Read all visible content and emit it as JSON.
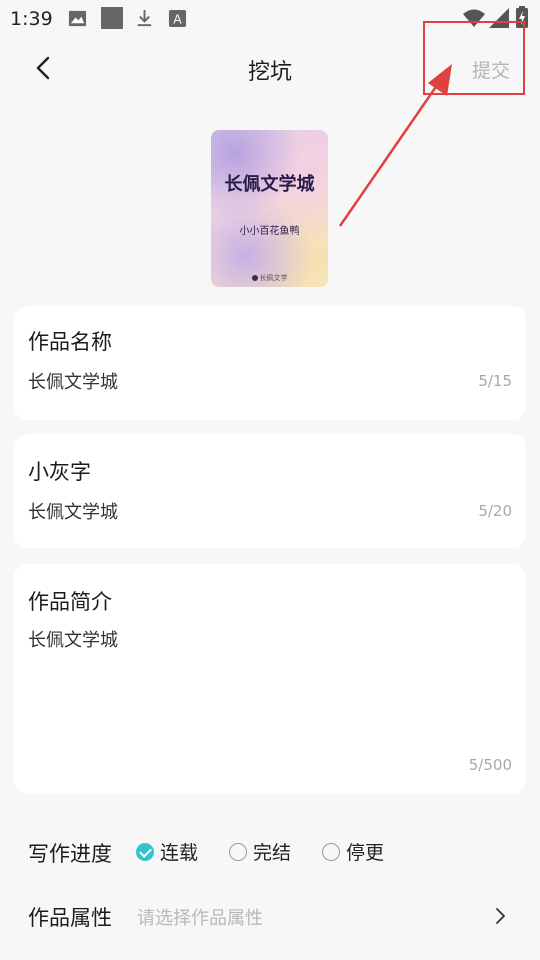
{
  "status_bar": {
    "time": "1:39",
    "icons": [
      "image-icon",
      "square-icon",
      "download-icon",
      "font-a-icon",
      "wifi-icon",
      "signal-icon",
      "battery-icon"
    ]
  },
  "header": {
    "title": "挖坑",
    "submit_label": "提交",
    "back_icon": "chevron-left-icon"
  },
  "cover": {
    "title": "长佩文学城",
    "author": "小小百花鱼鸭",
    "logo_text": "长佩文学"
  },
  "fields": {
    "work_name": {
      "label": "作品名称",
      "value": "长佩文学城",
      "count": "5/15"
    },
    "subtitle": {
      "label": "小灰字",
      "value": "长佩文学城",
      "count": "5/20"
    },
    "intro": {
      "label": "作品简介",
      "value": "长佩文学城",
      "count": "5/500"
    }
  },
  "progress": {
    "label": "写作进度",
    "options": [
      "连载",
      "完结",
      "停更"
    ],
    "selected": "连载"
  },
  "attributes": {
    "label": "作品属性",
    "placeholder": "请选择作品属性"
  },
  "colors": {
    "accent": "#34c4cf",
    "annotation": "#e0413e",
    "muted": "#b5b5b5"
  }
}
